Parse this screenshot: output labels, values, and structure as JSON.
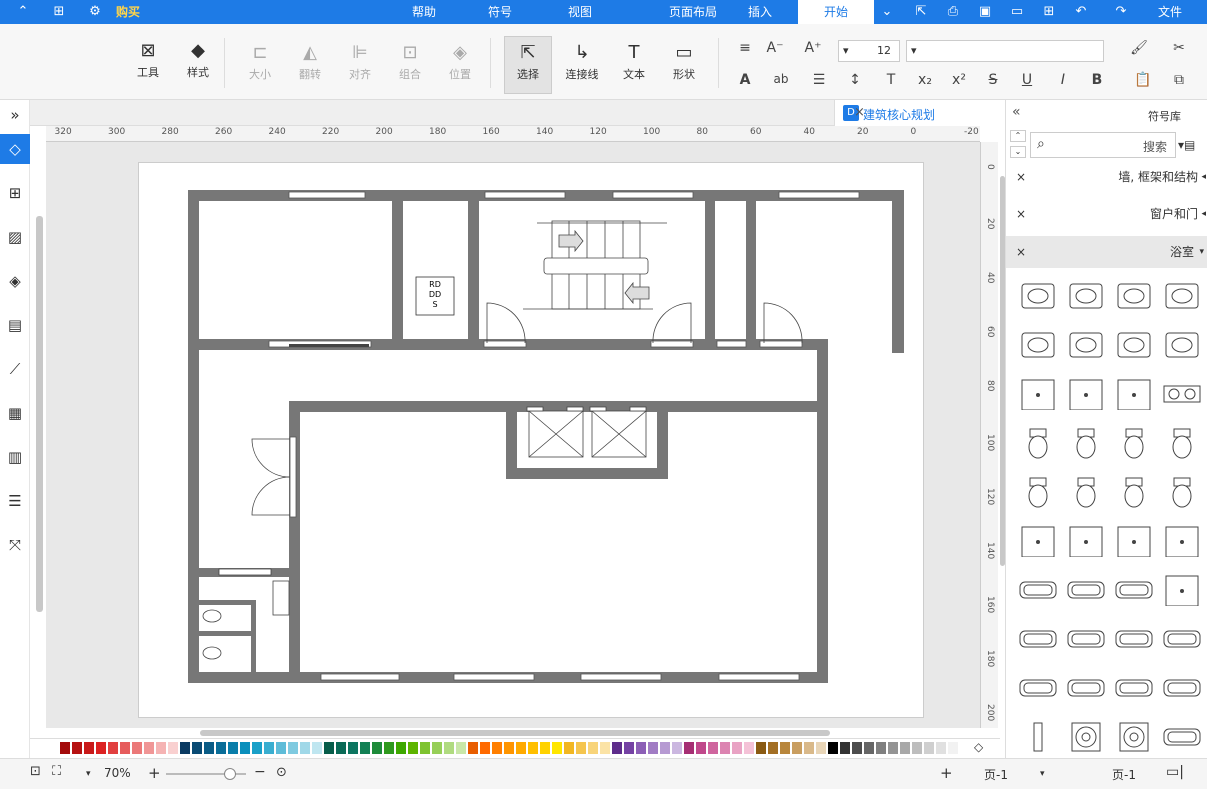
{
  "menu": {
    "file": "文件",
    "start": "开始",
    "insert": "插入",
    "page_layout": "页面布局",
    "view": "视图",
    "symbols": "符号",
    "help": "帮助",
    "buy": "购买"
  },
  "toolbar": {
    "tools": "工具",
    "style": "样式",
    "size": "大小",
    "flip": "翻转",
    "align": "对齐",
    "group": "组合",
    "position": "位置",
    "select": "选择",
    "connector": "连接线",
    "text": "文本",
    "shape": "形状",
    "font_size": "12",
    "font_name": ""
  },
  "document": {
    "tab_title": "建筑核心规划",
    "close": "×"
  },
  "ruler": {
    "h_ticks": [
      "-20",
      "0",
      "20",
      "40",
      "60",
      "80",
      "100",
      "120",
      "140",
      "160",
      "180",
      "200",
      "220",
      "240",
      "260",
      "280",
      "300",
      "320"
    ],
    "v_ticks": [
      "0",
      "20",
      "40",
      "60",
      "80",
      "100",
      "120",
      "140",
      "160",
      "180",
      "200"
    ]
  },
  "floorplan": {
    "rdds_label": "RD\nDD\nS",
    "rd": "RD",
    "dd": "DD",
    "s": "S"
  },
  "right_panel": {
    "title": "符号库",
    "search_placeholder": "搜索",
    "categories": [
      {
        "label": "墙, 框架和结构",
        "open": false
      },
      {
        "label": "窗户和门",
        "open": false
      },
      {
        "label": "浴室",
        "open": true
      }
    ]
  },
  "palette": {
    "colors": [
      "#ffffff",
      "#f2f2f2",
      "#e0e0e0",
      "#cfcfcf",
      "#bdbdbd",
      "#a8a8a8",
      "#949494",
      "#7f7f7f",
      "#666666",
      "#4d4d4d",
      "#333333",
      "#000000",
      "#e8d5b7",
      "#d9b98a",
      "#c99e60",
      "#b8863c",
      "#a36f24",
      "#8a5a12",
      "#f4c2d7",
      "#e9a3c4",
      "#dc84b1",
      "#cf659e",
      "#c0488b",
      "#a62e73",
      "#cbb7e0",
      "#b69ad2",
      "#a17cc4",
      "#8c5fb6",
      "#7542a4",
      "#5e2d8c",
      "#fbe3a6",
      "#f8d47a",
      "#f5c54e",
      "#f2b722",
      "#ffe600",
      "#ffd200",
      "#ffbf00",
      "#ffaa00",
      "#ff9500",
      "#ff7f00",
      "#ff6a00",
      "#e85d00",
      "#c9e7a8",
      "#b0db80",
      "#97cf58",
      "#7ec330",
      "#5db400",
      "#3ea800",
      "#2f9a1e",
      "#1e8b3a",
      "#128054",
      "#0c7560",
      "#0a6a56",
      "#075d4a",
      "#bfe6f0",
      "#a0d8e8",
      "#7fcae0",
      "#5ebcd8",
      "#3aaed0",
      "#1aa0c8",
      "#0a8fbc",
      "#0a7eaa",
      "#0a6d98",
      "#0a5c86",
      "#0a4b74",
      "#0a3a62",
      "#f9d0d0",
      "#f5b3b3",
      "#f09696",
      "#eb7979",
      "#e65c5c",
      "#e13f3f",
      "#dc2222",
      "#c91a1a",
      "#b61212",
      "#a30a0a"
    ]
  },
  "status": {
    "zoom": "70%",
    "page_sel": "页-1",
    "page_tab": "页-1",
    "add": "+",
    "minus": "−"
  }
}
